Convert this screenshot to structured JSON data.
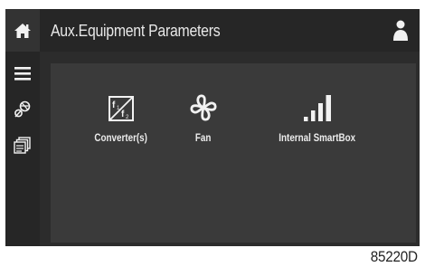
{
  "header": {
    "title": "Aux.Equipment Parameters",
    "home_icon": "home-icon",
    "user_icon": "user-icon"
  },
  "sidebar": {
    "items": [
      {
        "icon": "menu-icon"
      },
      {
        "icon": "tools-icon"
      },
      {
        "icon": "pages-icon"
      }
    ]
  },
  "tiles": [
    {
      "label": "Converter(s)",
      "icon": "frequency-converter-icon"
    },
    {
      "label": "Fan",
      "icon": "fan-icon"
    },
    {
      "label": "Internal SmartBox",
      "icon": "signal-bars-icon"
    }
  ],
  "figure_code": "85220D",
  "colors": {
    "background": "#2c2c2c",
    "panel": "#3a3a3a",
    "text": "#e8e8e8"
  }
}
